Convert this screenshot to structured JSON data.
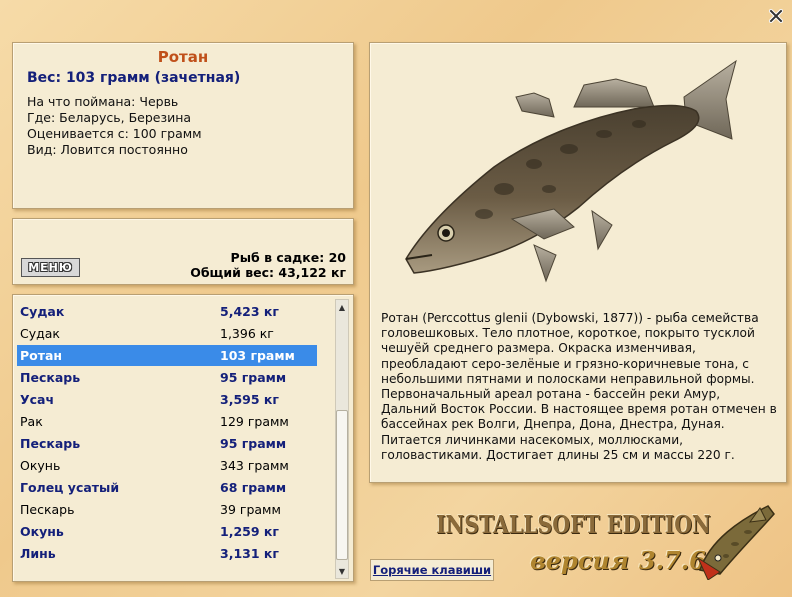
{
  "window": {
    "close_icon": "close-icon"
  },
  "fish_info": {
    "name": "Ротан",
    "weight_line": "Вес: 103 грамм (зачетная)",
    "lines": [
      "На что поймана: Червь",
      "Где: Беларусь, Березина",
      "Оценивается с: 100 грамм",
      "Вид: Ловится постоянно"
    ],
    "accent_color": "#c0501a",
    "text_color": "#14207a"
  },
  "cage": {
    "menu_label": "МЕНЮ",
    "fish_count": "Рыб в садке: 20",
    "total_weight": "Общий вес: 43,122 кг"
  },
  "catch_list": {
    "rows": [
      {
        "name": "Судак",
        "weight": "5,423 кг",
        "style": "bold"
      },
      {
        "name": "Судак",
        "weight": "1,396 кг",
        "style": "normal"
      },
      {
        "name": "Ротан",
        "weight": "103 грамм",
        "style": "selected"
      },
      {
        "name": "Пескарь",
        "weight": "95 грамм",
        "style": "bold"
      },
      {
        "name": "Усач",
        "weight": "3,595 кг",
        "style": "bold"
      },
      {
        "name": "Рак",
        "weight": "129 грамм",
        "style": "normal"
      },
      {
        "name": "Пескарь",
        "weight": "95 грамм",
        "style": "bold"
      },
      {
        "name": "Окунь",
        "weight": "343 грамм",
        "style": "normal"
      },
      {
        "name": "Голец усатый",
        "weight": "68 грамм",
        "style": "bold"
      },
      {
        "name": "Пескарь",
        "weight": "39 грамм",
        "style": "normal"
      },
      {
        "name": "Окунь",
        "weight": "1,259 кг",
        "style": "bold"
      },
      {
        "name": "Линь",
        "weight": "3,131 кг",
        "style": "bold"
      }
    ],
    "selected_color": "#3a8be8"
  },
  "description": "Ротан (Perccottus glenii (Dybowski, 1877)) - рыба семейства головешковых. Тело плотное, короткое, покрыто тусклой чешуёй среднего размера. Окраска изменчивая, преобладают серо-зелёные и грязно-коричневые тона, с небольшими пятнами и полосками неправильной формы. Первоначальный ареал ротана - бассейн реки Амур, Дальний Восток России. В настоящее время ротан отмечен в бассейнах рек Волги, Днепра, Дона, Днестра, Дуная. Питается личинками насекомых, моллюсками, головастиками. Достигает длины 25 см и массы 220 г.",
  "footer": {
    "hotkeys_label": "Горячие клавиши",
    "edition": "INSTALLSOFT EDITION",
    "version_word": "версия",
    "version_number": "3.7.6",
    "logo_icon": "pike-logo-icon"
  }
}
